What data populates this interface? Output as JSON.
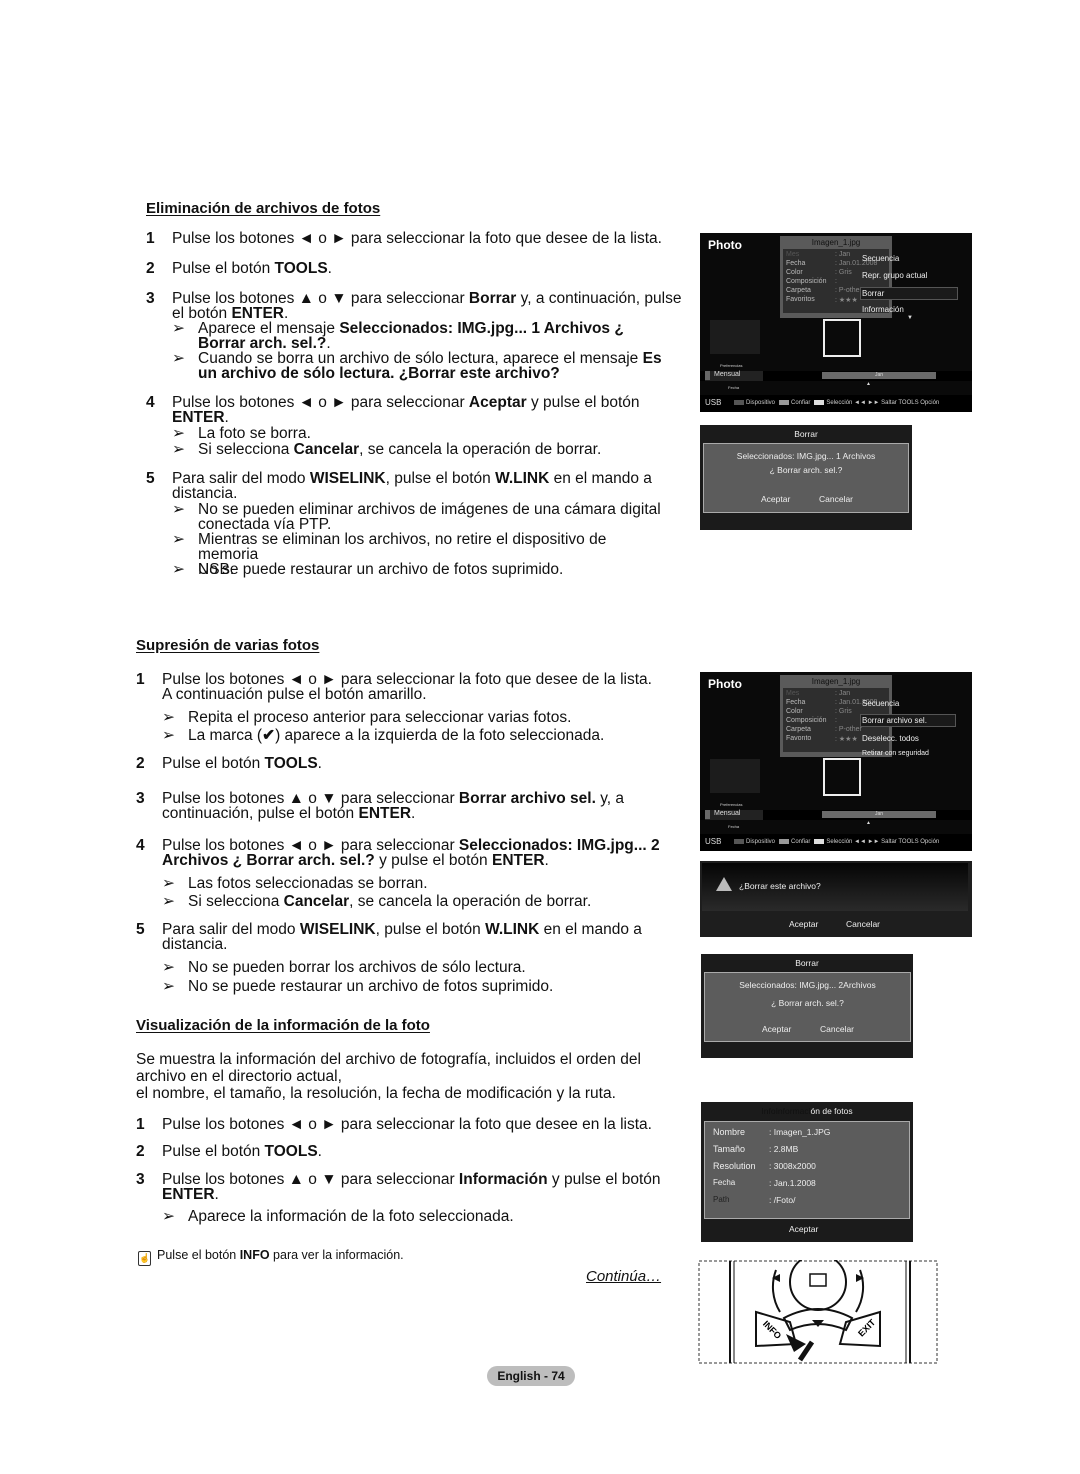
{
  "sections": [
    {
      "heading": "Eliminación de archivos de fotos",
      "steps": [
        {
          "num": "1",
          "lines": [
            "Pulse los botones ◄ o ► para seleccionar la foto que desee de la lista."
          ]
        },
        {
          "num": "2",
          "lines": [
            "Pulse el botón TOOLS."
          ]
        },
        {
          "num": "3",
          "lines": [
            "Pulse los botones ▲ o ▼ para seleccionar Borrar y, a continuación, pulse",
            "el botón ENTER."
          ],
          "notes": [
            [
              "Aparece el mensaje Seleccionados: IMG.jpg...   1 Archivos ¿",
              "Borrar arch. sel.?."
            ],
            [
              "Cuando se borra un archivo de sólo lectura, aparece el mensaje Es",
              "un archivo de sólo lectura. ¿Borrar este archivo?"
            ]
          ]
        },
        {
          "num": "4",
          "lines": [
            "Pulse los botones ◄ o ► para seleccionar Aceptar y pulse el botón",
            "ENTER."
          ],
          "notes": [
            [
              "La foto se borra."
            ],
            [
              "Si selecciona Cancelar, se cancela la operación de borrar."
            ]
          ]
        },
        {
          "num": "5",
          "lines": [
            "Para salir del modo WISELINK, pulse el botón W.LINK en el mando a",
            "distancia."
          ],
          "notes": [
            [
              "No se pueden eliminar archivos de imágenes de una cámara digital",
              "conectada vía PTP."
            ],
            [
              "Mientras se eliminan los archivos, no retire el dispositivo de memoria",
              "USB."
            ],
            [
              "No se puede restaurar un archivo de fotos suprimido."
            ]
          ]
        }
      ]
    },
    {
      "heading": "Supresión de varias fotos",
      "steps": [
        {
          "num": "1",
          "lines": [
            "Pulse los botones ◄ o ► para seleccionar la foto que desee de la lista.",
            "A continuación pulse el botón amarillo."
          ],
          "notes": [
            [
              "Repita el proceso anterior para seleccionar varias fotos."
            ],
            [
              "La marca (✔) aparece a la izquierda de la foto seleccionada."
            ]
          ]
        },
        {
          "num": "2",
          "lines": [
            "Pulse el botón TOOLS."
          ]
        },
        {
          "num": "3",
          "lines": [
            "Pulse los botones ▲ o ▼ para seleccionar Borrar archivo sel. y, a",
            "continuación, pulse el botón ENTER."
          ]
        },
        {
          "num": "4",
          "lines": [
            "Pulse los botones ◄ o ► para seleccionar Seleccionados: IMG.jpg... 2",
            "Archivos ¿ Borrar arch. sel.? y pulse el botón ENTER."
          ],
          "notes": [
            [
              "Las fotos seleccionadas se borran."
            ],
            [
              "Si selecciona Cancelar, se cancela la operación de borrar."
            ]
          ]
        },
        {
          "num": "5",
          "lines": [
            "Para salir del modo WISELINK, pulse el botón W.LINK en el mando a",
            "distancia."
          ],
          "notes": [
            [
              "No se pueden borrar los archivos de sólo lectura."
            ],
            [
              "No se puede restaurar un archivo de fotos suprimido."
            ]
          ]
        }
      ]
    },
    {
      "heading": "Visualización de la información de la foto",
      "intro": [
        "Se muestra la información del archivo de fotografía, incluidos el orden del",
        "archivo en el directorio actual,",
        "el nombre, el tamaño, la resolución, la fecha de modificación y la ruta."
      ],
      "steps": [
        {
          "num": "1",
          "lines": [
            "Pulse los botones ◄ o ► para seleccionar la foto que desee en la lista."
          ]
        },
        {
          "num": "2",
          "lines": [
            "Pulse el botón TOOLS."
          ]
        },
        {
          "num": "3",
          "lines": [
            "Pulse los botones ▲ o ▼ para seleccionar Información y pulse el botón",
            "ENTER."
          ],
          "notes": [
            [
              "Aparece la información de la foto seleccionada."
            ]
          ]
        }
      ]
    }
  ],
  "tip": "Pulse el botón INFO para ver la información.",
  "continues": "Continúa…",
  "page_label": "English - 74",
  "note_arrow": "➢",
  "screens": [
    {
      "title": "Photo",
      "filename": "Imagen_1.jpg",
      "info_rows": [
        [
          "Mes",
          ": Jan"
        ],
        [
          "Fecha",
          ": Jan.01.2008"
        ],
        [
          "Color",
          ": Gris"
        ],
        [
          "Composición",
          ":"
        ],
        [
          "Carpeta",
          ": P-other"
        ],
        [
          "Favoritos",
          ": ★★★"
        ]
      ],
      "menu": [
        "Secuencia",
        "Repr. grupo actual",
        "Borrar",
        "Información"
      ],
      "selected": 2,
      "pref": "Preferencias",
      "mode": "Mensual",
      "fecha": "Fecha",
      "timeline": "Jan",
      "footer": {
        "source": "USB",
        "items": [
          "Dispositivo",
          "Confiar",
          "Selección",
          "◄◄ ►► Saltar",
          "TOOLS Opción"
        ]
      }
    },
    {
      "title": "Photo",
      "filename": "Imagen_1.jpg",
      "info_rows": [
        [
          "Mes",
          ": Jan"
        ],
        [
          "Fecha",
          ": Jan.01.2008"
        ],
        [
          "Color",
          ": Gris"
        ],
        [
          "Composición",
          ":"
        ],
        [
          "Carpeta",
          ": P-other"
        ],
        [
          "Favonto",
          ": ★★★"
        ]
      ],
      "menu": [
        "Secuencia",
        "Borrar archivo sel.",
        "Deselecc. todos",
        "Retirar con seguridad"
      ],
      "selected": 1,
      "pref": "Preferencias",
      "mode": "Mensual",
      "fecha": "Fecha",
      "timeline": "Jan",
      "footer": {
        "source": "USB",
        "items": [
          "Dispositivo",
          "Confiar",
          "Selección",
          "◄◄ ►► Saltar",
          "TOOLS Opción"
        ]
      }
    }
  ],
  "dialogs": {
    "delete1": {
      "title": "Borrar",
      "line1": "Seleccionados: IMG.jpg...    1 Archivos",
      "line2": "¿ Borrar arch. sel.?",
      "ok": "Aceptar",
      "cancel": "Cancelar"
    },
    "readonly": {
      "message": "¿Borrar este archivo?",
      "ok": "Aceptar",
      "cancel": "Cancelar"
    },
    "delete2": {
      "title": "Borrar",
      "line1": "Seleccionados: IMG.jpg...   2Archivos",
      "line2": "¿ Borrar arch. sel.?",
      "ok": "Aceptar",
      "cancel": "Cancelar"
    },
    "info": {
      "title_dim": "InfoInformaci",
      "title": "ón de fotos",
      "rows": [
        [
          "Nombre",
          ": Imagen_1.JPG"
        ],
        [
          "Tamaño",
          ": 2.8MB"
        ],
        [
          "Resolution",
          ": 3008x2000"
        ],
        [
          "Fecha",
          ": Jan.1.2008"
        ],
        [
          "Path",
          ": /Foto/"
        ]
      ],
      "ok": "Aceptar"
    }
  },
  "remote": {
    "info_label": "INFO",
    "exit_label": "EXIT"
  }
}
